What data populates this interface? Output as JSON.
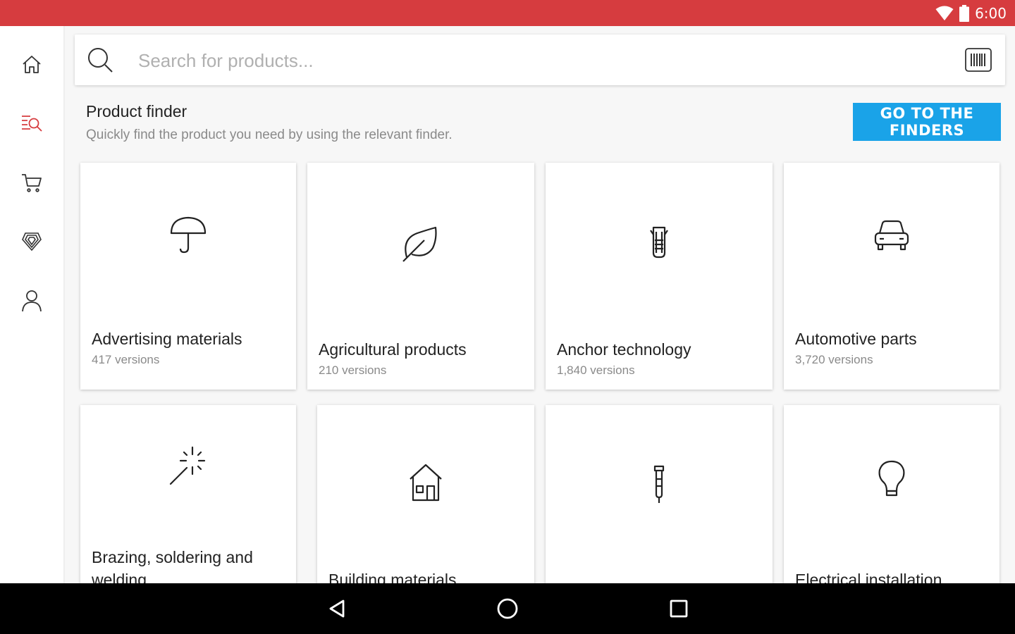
{
  "status_bar": {
    "time": "6:00",
    "icons": [
      "wifi-icon",
      "battery-icon"
    ],
    "background": "#d63c3f"
  },
  "sidebar": {
    "items": [
      {
        "name": "home",
        "icon": "home-icon",
        "active": false
      },
      {
        "name": "product-search",
        "icon": "list-search-icon",
        "active": true
      },
      {
        "name": "cart",
        "icon": "cart-icon",
        "active": false
      },
      {
        "name": "offers",
        "icon": "badge-icon",
        "active": false
      },
      {
        "name": "account",
        "icon": "user-icon",
        "active": false
      }
    ],
    "active_color": "#d63c3f"
  },
  "search": {
    "placeholder": "Search for products...",
    "value": ""
  },
  "finder": {
    "title": "Product finder",
    "subtitle": "Quickly find the product you need by using the relevant finder.",
    "button_label": "GO TO THE FINDERS",
    "button_color": "#1aa3e8"
  },
  "categories": [
    {
      "title": "Advertising materials",
      "versions": "417 versions",
      "icon": "umbrella-icon"
    },
    {
      "title": "Agricultural products",
      "versions": "210 versions",
      "icon": "leaf-icon"
    },
    {
      "title": "Anchor technology",
      "versions": "1,840 versions",
      "icon": "anchor-plug-icon"
    },
    {
      "title": "Automotive parts",
      "versions": "3,720 versions",
      "icon": "car-icon"
    },
    {
      "title": "Brazing, soldering and welding",
      "versions": "",
      "icon": "sparkle-wand-icon"
    },
    {
      "title": "Building materials",
      "versions": "",
      "icon": "house-icon"
    },
    {
      "title": "",
      "versions": "",
      "icon": "rivet-icon"
    },
    {
      "title": "Electrical installation",
      "versions": "",
      "icon": "lightbulb-icon"
    }
  ],
  "nav_bar": {
    "buttons": [
      "back-icon",
      "home-circle-icon",
      "recents-square-icon"
    ]
  }
}
